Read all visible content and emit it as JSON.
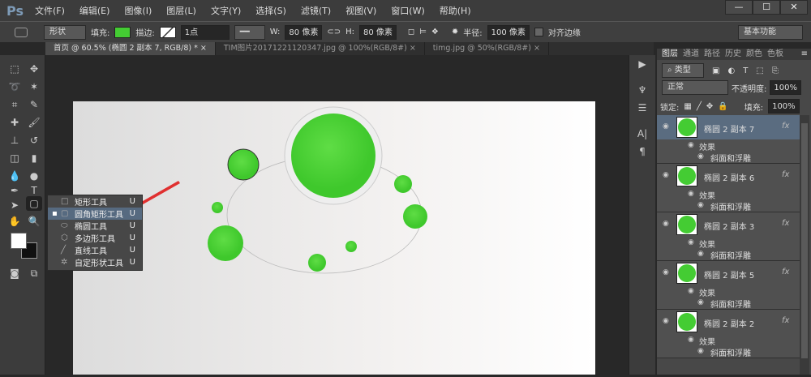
{
  "app": {
    "logo": "Ps",
    "menus": [
      "文件(F)",
      "编辑(E)",
      "图像(I)",
      "图层(L)",
      "文字(Y)",
      "选择(S)",
      "滤镜(T)",
      "视图(V)",
      "窗口(W)",
      "帮助(H)"
    ],
    "window_buttons": [
      "—",
      "☐",
      "✕"
    ]
  },
  "options": {
    "mode": "形状",
    "fill_label": "填充:",
    "fill_color": "#44cc33",
    "stroke_label": "描边:",
    "stroke_width": "1点",
    "w_label": "W:",
    "w_value": "80 像素",
    "h_label": "H:",
    "h_value": "80 像素",
    "radius_label": "半径:",
    "radius_value": "100 像素",
    "align_edges": "对齐边缘",
    "workspace": "基本功能"
  },
  "tabs": [
    {
      "label": "首页 @ 60.5% (椭圆 2 副本 7, RGB/8) *",
      "close": "×"
    },
    {
      "label": "TIM图片20171221120347.jpg @ 100%(RGB/8#)",
      "close": "×"
    },
    {
      "label": "timg.jpg @ 50%(RGB/8#)",
      "close": "×"
    }
  ],
  "flyout": [
    {
      "label": "矩形工具",
      "key": "U",
      "icon": "□"
    },
    {
      "label": "圆角矩形工具",
      "key": "U",
      "icon": "▢",
      "selected": true
    },
    {
      "label": "椭圆工具",
      "key": "U",
      "icon": "⬭"
    },
    {
      "label": "多边形工具",
      "key": "U",
      "icon": "⬡"
    },
    {
      "label": "直线工具",
      "key": "U",
      "icon": "╱"
    },
    {
      "label": "自定形状工具",
      "key": "U",
      "icon": "✲"
    }
  ],
  "layers_panel": {
    "tabs": [
      "图层",
      "通道",
      "路径",
      "历史",
      "颜色",
      "色板"
    ],
    "filter": "类型",
    "blend": "正常",
    "opacity_label": "不透明度:",
    "opacity": "100%",
    "lock_label": "锁定:",
    "fill_label": "填充:",
    "fill": "100%",
    "layers": [
      {
        "name": "椭圆 2 副本 7",
        "effects": "效果",
        "effect": "斜面和浮雕",
        "fx": "fx"
      },
      {
        "name": "椭圆 2 副本 6",
        "effects": "效果",
        "effect": "斜面和浮雕",
        "fx": "fx"
      },
      {
        "name": "椭圆 2 副本 3",
        "effects": "效果",
        "effect": "斜面和浮雕",
        "fx": "fx"
      },
      {
        "name": "椭圆 2 副本 5",
        "effects": "效果",
        "effect": "斜面和浮雕",
        "fx": "fx"
      },
      {
        "name": "椭圆 2 副本 2",
        "effects": "效果",
        "effect": "斜面和浮雕",
        "fx": "fx"
      }
    ]
  },
  "colors": {
    "green": "#44cc33",
    "panel": "#484848",
    "selection": "#566a80"
  }
}
